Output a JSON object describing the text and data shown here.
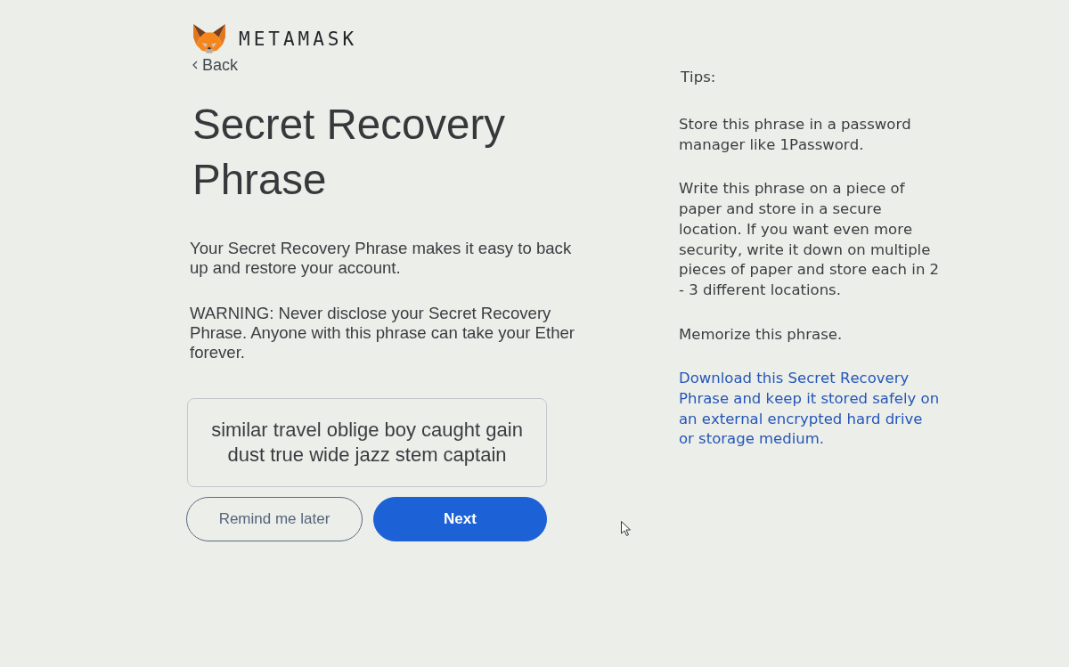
{
  "logo": {
    "wordmark": "METAMASK"
  },
  "back_link": {
    "label": "Back"
  },
  "title": "Secret Recovery Phrase",
  "description": "Your Secret Recovery Phrase makes it easy to back up and restore your account.",
  "warning": "WARNING: Never disclose your Secret Recovery Phrase. Anyone with this phrase can take your Ether forever.",
  "phrase": "similar travel oblige boy caught gain dust true wide jazz stem captain",
  "buttons": [
    {
      "label": "Remind me later",
      "kind": "secondary"
    },
    {
      "label": "Next",
      "kind": "primary"
    }
  ],
  "tips": {
    "heading": "Tips:",
    "items": [
      {
        "kind": "text",
        "text": "Store this phrase in a password manager like 1Password."
      },
      {
        "kind": "text",
        "text": "Write this phrase on a piece of paper and store in a secure location. If you want even more security, write it down on multiple pieces of paper and store each in 2 - 3 different locations."
      },
      {
        "kind": "text",
        "text": "Memorize this phrase."
      },
      {
        "kind": "link",
        "text": "Download this Secret Recovery Phrase and keep it stored safely on an external encrypted hard drive or storage medium."
      }
    ]
  }
}
